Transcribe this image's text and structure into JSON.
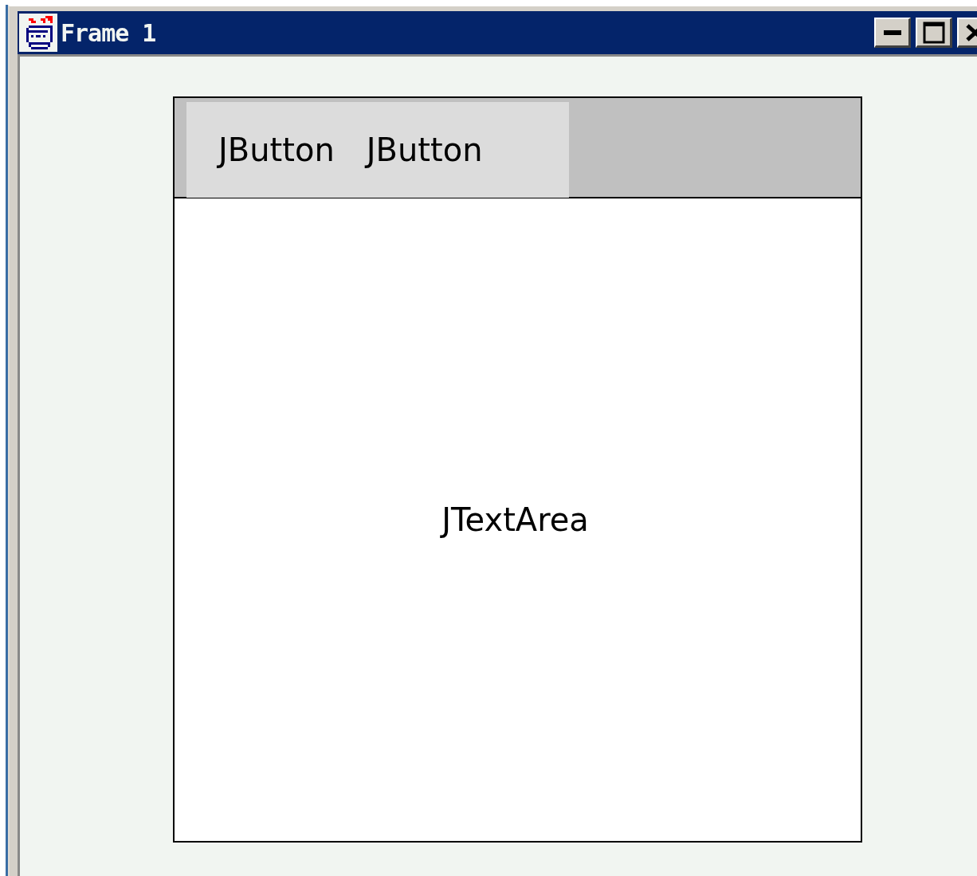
{
  "window": {
    "title": "Frame 1"
  },
  "toolbar": {
    "buttons": [
      "JButton",
      "JButton"
    ]
  },
  "text_area": {
    "text": "JTextArea"
  }
}
